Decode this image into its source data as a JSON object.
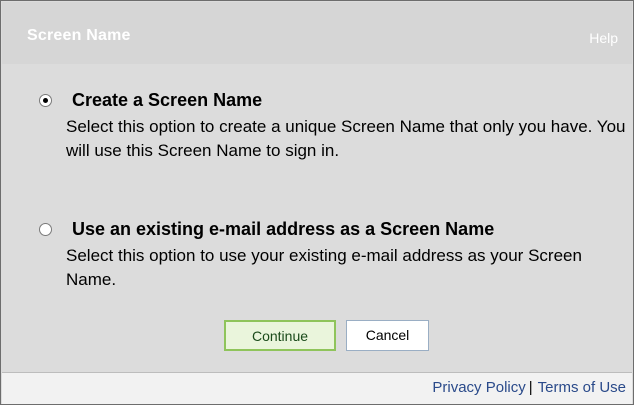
{
  "header": {
    "title": "Screen Name",
    "help_label": "Help"
  },
  "options": [
    {
      "label": "Create a Screen Name",
      "description": "Select this option to create a unique Screen Name that only you have. You will use this Screen Name to sign in.",
      "selected": true
    },
    {
      "label": "Use an existing e-mail address as a Screen Name",
      "description": "Select this option to use your existing e-mail address as your Screen Name.",
      "selected": false
    }
  ],
  "buttons": {
    "continue_label": "Continue",
    "cancel_label": "Cancel"
  },
  "footer": {
    "privacy_label": "Privacy Policy",
    "separator": "|",
    "terms_label": "Terms of Use"
  },
  "colors": {
    "panel_bg": "#dcdcdc",
    "footer_bg": "#f2f2f2",
    "continue_border": "#8fc45b",
    "link": "#2a4a8a"
  }
}
